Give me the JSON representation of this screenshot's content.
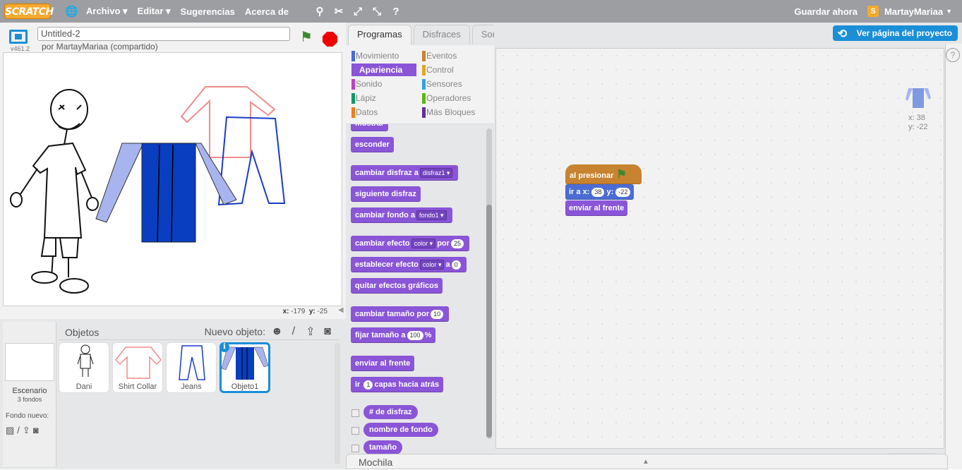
{
  "menu": {
    "logo": "SCRATCH",
    "items": [
      "Archivo ▾",
      "Editar ▾",
      "Sugerencias",
      "Acerca de"
    ],
    "save_now": "Guardar ahora",
    "username": "MartayMariaa",
    "user_avatar_letter": "S"
  },
  "stage_header": {
    "version": "v461.2",
    "title": "Untitled-2",
    "byline": "por MartayMariaa (compartido)"
  },
  "mouse": {
    "x_label": "x:",
    "x": "-179",
    "y_label": "y:",
    "y": "-25"
  },
  "sprites": {
    "objects_label": "Objetos",
    "new_object_label": "Nuevo objeto:",
    "stage_label": "Escenario",
    "stage_sub": "3 fondos",
    "bg_new_label": "Fondo nuevo:",
    "list": [
      {
        "name": "Dani"
      },
      {
        "name": "Shirt Collar"
      },
      {
        "name": "Jeans"
      },
      {
        "name": "Objeto1",
        "selected": true
      }
    ]
  },
  "tabs": [
    "Programas",
    "Disfraces",
    "Sonidos"
  ],
  "categories": [
    {
      "label": "Movimiento",
      "color": "#4a6cd4"
    },
    {
      "label": "Eventos",
      "color": "#c88330"
    },
    {
      "label": "Apariencia",
      "color": "#8a55d7",
      "active": true
    },
    {
      "label": "Control",
      "color": "#e1a91a"
    },
    {
      "label": "Sonido",
      "color": "#bb42c3"
    },
    {
      "label": "Sensores",
      "color": "#2ca5e2"
    },
    {
      "label": "Lápiz",
      "color": "#0e9a6c"
    },
    {
      "label": "Operadores",
      "color": "#5cb712"
    },
    {
      "label": "Datos",
      "color": "#ee7d16"
    },
    {
      "label": "Más Bloques",
      "color": "#632d99"
    }
  ],
  "palette": {
    "mostrar": "mostrar",
    "esconder": "esconder",
    "cambiar_disfraz": "cambiar disfraz a",
    "disfraz_val": "disfraz1",
    "siguiente_disfraz": "siguiente disfraz",
    "cambiar_fondo": "cambiar fondo a",
    "fondo_val": "fondo1",
    "cambiar_efecto": "cambiar efecto",
    "efecto_val": "color",
    "por": "por",
    "efecto_num": "25",
    "establecer_efecto": "establecer efecto",
    "a": "a",
    "establecer_num": "0",
    "quitar_efectos": "quitar efectos gráficos",
    "cambiar_tamano": "cambiar tamaño por",
    "tamano_num": "10",
    "fijar_tamano": "fijar tamaño a",
    "fijar_num": "100",
    "pct": "%",
    "enviar_frente": "enviar al frente",
    "ir": "ir",
    "capas_num": "1",
    "capas": "capas hacia atrás",
    "num_disfraz": "# de disfraz",
    "nombre_fondo": "nombre de fondo",
    "tamano": "tamaño"
  },
  "script_area": {
    "ver_pagina": "Ver página del proyecto",
    "help": "?",
    "hat": "al presionar",
    "goto_ir": "ir a x:",
    "goto_x": "38",
    "goto_y_label": "y:",
    "goto_y": "-22",
    "front": "enviar al frente",
    "sprite_x": "x: 38",
    "sprite_y": "y: -22"
  },
  "backpack": "Mochila"
}
